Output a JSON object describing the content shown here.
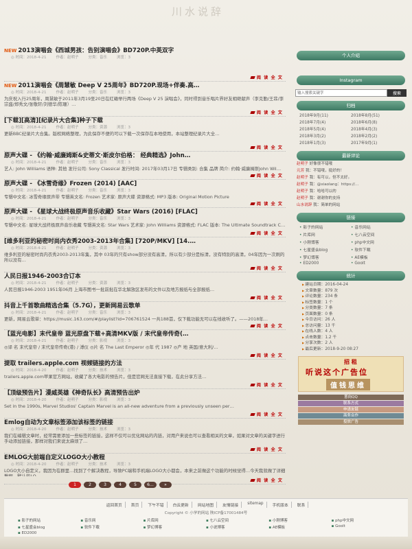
{
  "site_logo": "川水说辞",
  "posts": [
    {
      "title": "2013演唱会《西城男孩：告别演唱会》BD720P.中英双字",
      "new": "NEW",
      "meta": [
        "◎ 时间：2018-4-21",
        "作者：赵明子",
        "分类：音乐",
        "浏览：3"
      ],
      "excerpt": "",
      "h": 50
    },
    {
      "title": "2011演唱会《周慧敏 Deep V 25周年》BD720P.现场+伴奏.高…",
      "new": "NEW",
      "meta": [
        "◎ 时间：2018-4-21",
        "作者：赵明子",
        "分类：音乐",
        "浏览：3"
      ],
      "excerpt": "为庆祝入行25周年，周慧敏于2011年3月19至20日在红磡举行两场《Deep V 25 演唱会》，同时得到音乐唱片界好友相继献声（李克勤/王菲/李宗盛/郑秀文/张敬轩/刘德华/陈珊）…",
      "h": 50
    },
    {
      "title": "[下载][高清][纪录片大合集]种子下载",
      "new": "",
      "meta": [
        "◎ 时间：2018-4-21",
        "作者：赵明子",
        "分类：资源",
        "浏览：3"
      ],
      "excerpt": "更新BBC纪录片大合集。版权网络整理，为此保存不便的可以下载一次保存在本地使用，本站整理纪录片大全…",
      "h": 50
    },
    {
      "title": "原声大碟 - 《约翰·威廉姆斯&史蒂文·斯皮尔伯格： 经典精选》John…",
      "new": "",
      "meta": [
        "◎ 时间：2018-4-21",
        "作者：赵明子",
        "分类：音乐",
        "浏览：3"
      ],
      "excerpt": "艺人: John Williams 语种: 其他 发行公司: Sony Classical 发行时间: 2017年03月17日 专辑类别: 合集 品牌 简介: 约翰·威廉姆斯John Wil…",
      "h": 40
    },
    {
      "title": "原声大碟 - 《冰雪奇缘》Frozen (2014) [AAC]",
      "new": "",
      "meta": [
        "◎ 时间：2018-4-21",
        "作者：赵明子",
        "分类：音乐",
        "浏览：3"
      ],
      "excerpt": "专辑中文名: 冰雪奇缘原声带 专辑英文名: Frozen 艺术家: 原声大碟 资源格式: MP3 版本: Original Motion Picture Soundtrack[Oh+Fre+Jpn…",
      "h": 40
    },
    {
      "title": "原声大碟 - 《星球大战终极原声音乐收藏》Star Wars (2016) [FLAC]",
      "new": "",
      "meta": [
        "◎ 时间：2018-4-21",
        "作者：赵明子",
        "分类：音乐",
        "浏览：3"
      ],
      "excerpt": "专辑中文名: 星球大战终极原声音乐收藏 专辑英文名: Star Wars 艺术家: John Williams 资源格式: FLAC 版本: The Ultimate Soundtrack C…",
      "h": 42
    },
    {
      "title": "[维多利亚的秘密时尚内衣秀2003-2013年合集] [720P/MKV] [14.…",
      "new": "",
      "meta": [
        "◎ 时间：2018-4-21",
        "作者：赵明子",
        "分类：资源",
        "浏览：3"
      ],
      "excerpt": "维多利亚的秘密时尚内衣秀2003-2013年集，其中 03年的只有show部分没有高清，所以有少部分是标清，没有特别的高清，04年因为一次刷的所以没有…",
      "h": 50
    },
    {
      "title": "人民日报1946-2003合订本",
      "new": "",
      "meta": [
        "◎ 时间：2018-4-21",
        "作者：赵明子",
        "分类：资源",
        "浏览：3"
      ],
      "excerpt": "人民日报1946-2003 1951年06月 上海市图书一批前批在华北解放区发布的文件以及地方报纸与全部报纸…",
      "h": 42
    },
    {
      "title": "抖音上千首歌曲精选合集（5.7G），更新网易云歌单",
      "new": "",
      "meta": [
        "◎ 时间：2018-4-21",
        "作者：赵明子",
        "分类：音乐",
        "浏览：3"
      ],
      "excerpt": "更新，网易云歌单：https://music.163.com/#/playlist?id=706761524 一共188首，仅下载功能无可以在线收听了。——2018年…",
      "h": 40
    },
    {
      "title": "【蓝光电影】末代皇帝 蓝光原盘下载+高清MKV版 / 末代皇帝传奇(…",
      "new": "",
      "meta": [
        "◎ 时间：2018-4-21",
        "作者：赵明子",
        "分类：影视",
        "浏览：3"
      ],
      "excerpt": "◎译 名 末代皇帝 / 末代皇帝传奇(港) / 溥仪 ◎片 名 The Last Emperor ◎年 代 1987 ◎产 地 英国/意大利/…",
      "h": 42
    },
    {
      "title": "提取 trailers.apple.com 视频链接的方法",
      "new": "",
      "meta": [
        "◎ 时间：2018-4-20",
        "作者：赵明子",
        "分类：技术",
        "浏览：3"
      ],
      "excerpt": "trailers.apple.com苹果官方网站，收藏了各大电影的预告片，但是官网无法直接下载，在此分享方法…",
      "h": 42
    },
    {
      "title": "【顶级预告片】漫威英雄《神奇队长》高清预告出炉",
      "new": "",
      "meta": [
        "◎ 时间：2018-4-20",
        "作者：赵明子",
        "分类：影视",
        "浏览：3"
      ],
      "excerpt": "Set in the 1990s, Marvel Studios' Captain Marvel is an all-new adventure from a previously unseen per…",
      "h": 42
    },
    {
      "title": "Emlog自动为文章标签添加该标签的链接",
      "new": "",
      "meta": [
        "◎ 时间：2018-4-20",
        "作者：赵明子",
        "分类：技术",
        "浏览：3"
      ],
      "excerpt": "我们在编辑文章时，经常需要添加一些标签的链接，这样不仅可以优化网站的内链，对用户来说也可以查看相关的文章，如果对文章的关键字进行手动添加链接，那样对我们来说太麻烦了…",
      "h": 50
    },
    {
      "title": "EMLOG大前端自定义LOGO大小教程",
      "new": "",
      "meta": [
        "◎ 时间：2018-4-20",
        "作者：赵明子",
        "分类：技术",
        "浏览：3"
      ],
      "excerpt": "LOGO大小自定义，我因为在群里…找到了个解决教程，导致PC端和手机端LOGO大小都会，本来之前做这个功能的时候觉得…今天我就做了详细教程，默认的LO…",
      "h": 44
    }
  ],
  "readmore": "阅 读 全 文",
  "pager": [
    "1",
    "2",
    "3",
    "4",
    "5",
    "6…",
    "»"
  ],
  "sidebar": {
    "banner1": "个人介绍",
    "banner2": "Instagram",
    "search_placeholder": "输入搜索关键字",
    "search_btn": "搜索",
    "banner3": "归档",
    "archives": [
      "2018年9月(11)",
      "2018年8月(51)",
      "2018年7月(4)",
      "2018年6月(8)",
      "2018年5月(4)",
      "2018年4月(3)",
      "2018年3月(2)",
      "2018年2月(2)",
      "2018年1月(3)",
      "2017年9月(1)"
    ],
    "banner4": "最新评论",
    "comments": [
      {
        "who": "赵明子",
        "text": "好像很不错哦"
      },
      {
        "who": "元芳",
        "text": "我：不错哦，挺好的！"
      },
      {
        "who": "赵明子",
        "text": "我：有可以，但不太好。"
      },
      {
        "who": "赵明子",
        "text": "我：@xiaolang：https://…"
      },
      {
        "who": "赵明子",
        "text": "我：哈哈可以的"
      },
      {
        "who": "赵明子",
        "text": "我：谢谢你的支持"
      },
      {
        "who": "山水说辞",
        "text": "我：简单的网站"
      }
    ],
    "banner5": "链接",
    "nav": [
      "影子的网站",
      "音乐网站",
      "片库网",
      "七八云空间",
      "小刚博客",
      "php中文网",
      "七星盛会blog",
      "软件下载",
      "梦幻博客",
      "AE模板",
      "ED2000",
      "Goolt"
    ],
    "banner6": "统计",
    "stats": [
      "建站日期：2016-04-24",
      "文章数量：879 次",
      "评论数量：234 条",
      "标签数量：1 个",
      "分类数量：7 条",
      "页面数量：0 条",
      "今日访问：26 人",
      "总访问量：13 千",
      "在线人数：4 人",
      "点击数量：1.2 千",
      "分享次数：2 人",
      "最后更新：2018-9-20 08:27"
    ],
    "ad_small": "招  租",
    "ad_big": "听说这个广告位",
    "ad_tag": "值钱思维",
    "bars": [
      {
        "text": "意向QQ",
        "color": "#7e6a58"
      },
      {
        "text": "联系方式",
        "color": "#9b7aa0"
      },
      {
        "text": "申请友链",
        "color": "#c79a80"
      },
      {
        "text": "商务合作",
        "color": "#6f8a94"
      },
      {
        "text": "投放广告",
        "color": "#a88f70"
      }
    ]
  },
  "footer": {
    "nav": [
      "返回首页",
      "首页",
      "下午不错",
      "白云更新",
      "网站地图",
      "友情链接",
      "sitemap",
      "手机版本",
      "联系"
    ],
    "copyright": "Copyright © 小学的网站  陕ICP备17001484号",
    "links": [
      "影子的网站",
      "音乐网",
      "片库网",
      "七八云空间",
      "小刚博客",
      "php中文网",
      "七星盛会blog",
      "软件下载",
      "梦幻博客",
      "小说博客",
      "AE模板",
      "Goolt",
      "ED2000"
    ]
  }
}
